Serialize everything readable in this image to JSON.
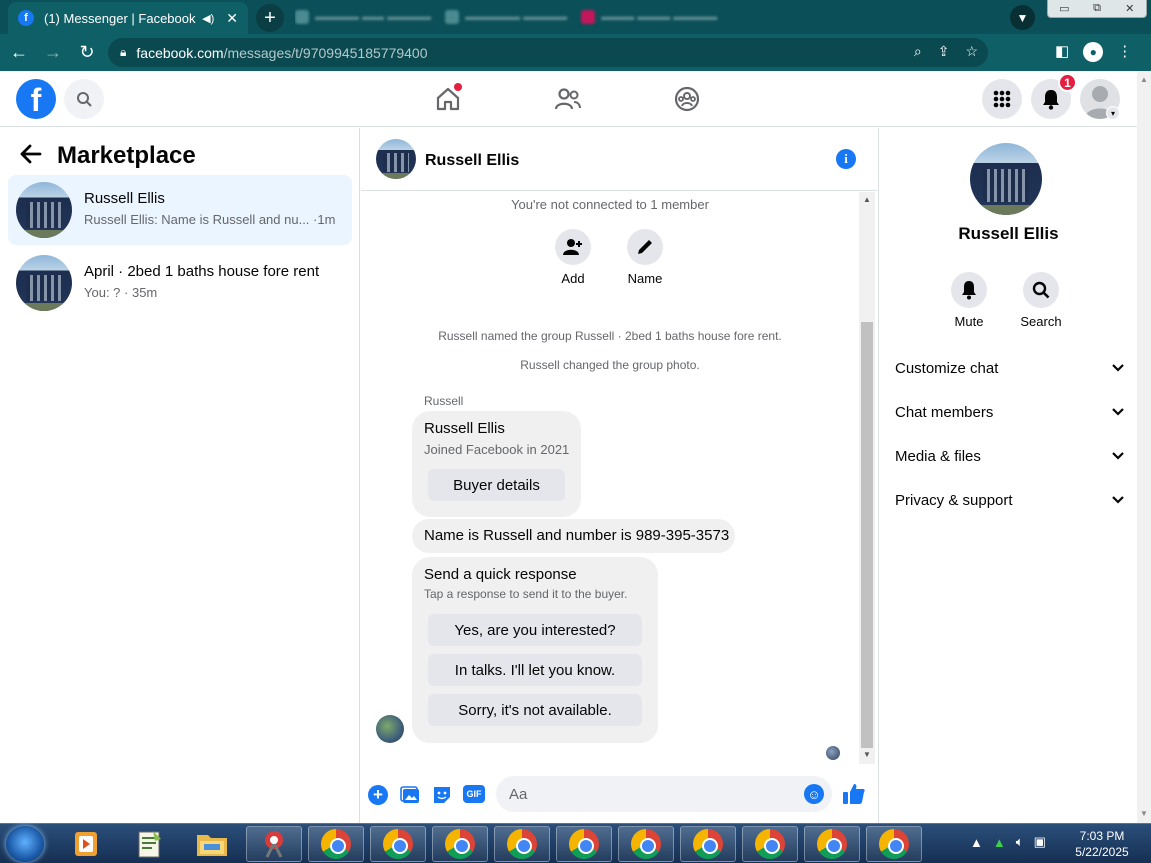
{
  "browser": {
    "tab_title": "(1) Messenger | Facebook",
    "tab_close": "✕",
    "new_tab": "+",
    "url_host": "facebook.com",
    "url_path": "/messages/t/9709945185779400",
    "window_controls": [
      "▭",
      "⧉",
      "✕"
    ]
  },
  "header": {
    "notification_count": "1"
  },
  "left_panel": {
    "title": "Marketplace",
    "conversations": [
      {
        "name": "Russell Ellis",
        "preview": "Russell Ellis: Name is Russell and nu...",
        "time": "·1m"
      },
      {
        "name": "April · 2bed 1 baths house fore rent",
        "preview": "You: ?",
        "time": "· 35m"
      }
    ]
  },
  "chat": {
    "header_name": "Russell Ellis",
    "not_connected": "You're not connected to 1 member",
    "actions": [
      {
        "label": "Add",
        "icon": "add-person-icon"
      },
      {
        "label": "Name",
        "icon": "pencil-icon"
      }
    ],
    "system_messages": [
      "Russell named the group Russell · 2bed 1 baths house fore rent.",
      "Russell changed the group photo."
    ],
    "sender_label": "Russell",
    "profile_card": {
      "name": "Russell Ellis",
      "joined": "Joined Facebook in 2021",
      "button": "Buyer details"
    },
    "message": "Name is Russell and number is 989-395-3573",
    "quick_response": {
      "title": "Send a quick response",
      "subtitle": "Tap a response to send it to the buyer.",
      "options": [
        "Yes, are you interested?",
        "In talks. I'll let you know.",
        "Sorry, it's not available."
      ]
    },
    "composer_placeholder": "Aa"
  },
  "right_panel": {
    "name": "Russell Ellis",
    "actions": [
      {
        "label": "Mute",
        "icon": "bell-icon"
      },
      {
        "label": "Search",
        "icon": "search-icon"
      }
    ],
    "sections": [
      "Customize chat",
      "Chat members",
      "Media & files",
      "Privacy & support"
    ]
  },
  "taskbar": {
    "time": "7:03 PM",
    "date": "5/22/2025"
  },
  "colors": {
    "accent": "#1877f2",
    "browser_frame": "#0f5f67",
    "badge": "#e41e3f"
  }
}
